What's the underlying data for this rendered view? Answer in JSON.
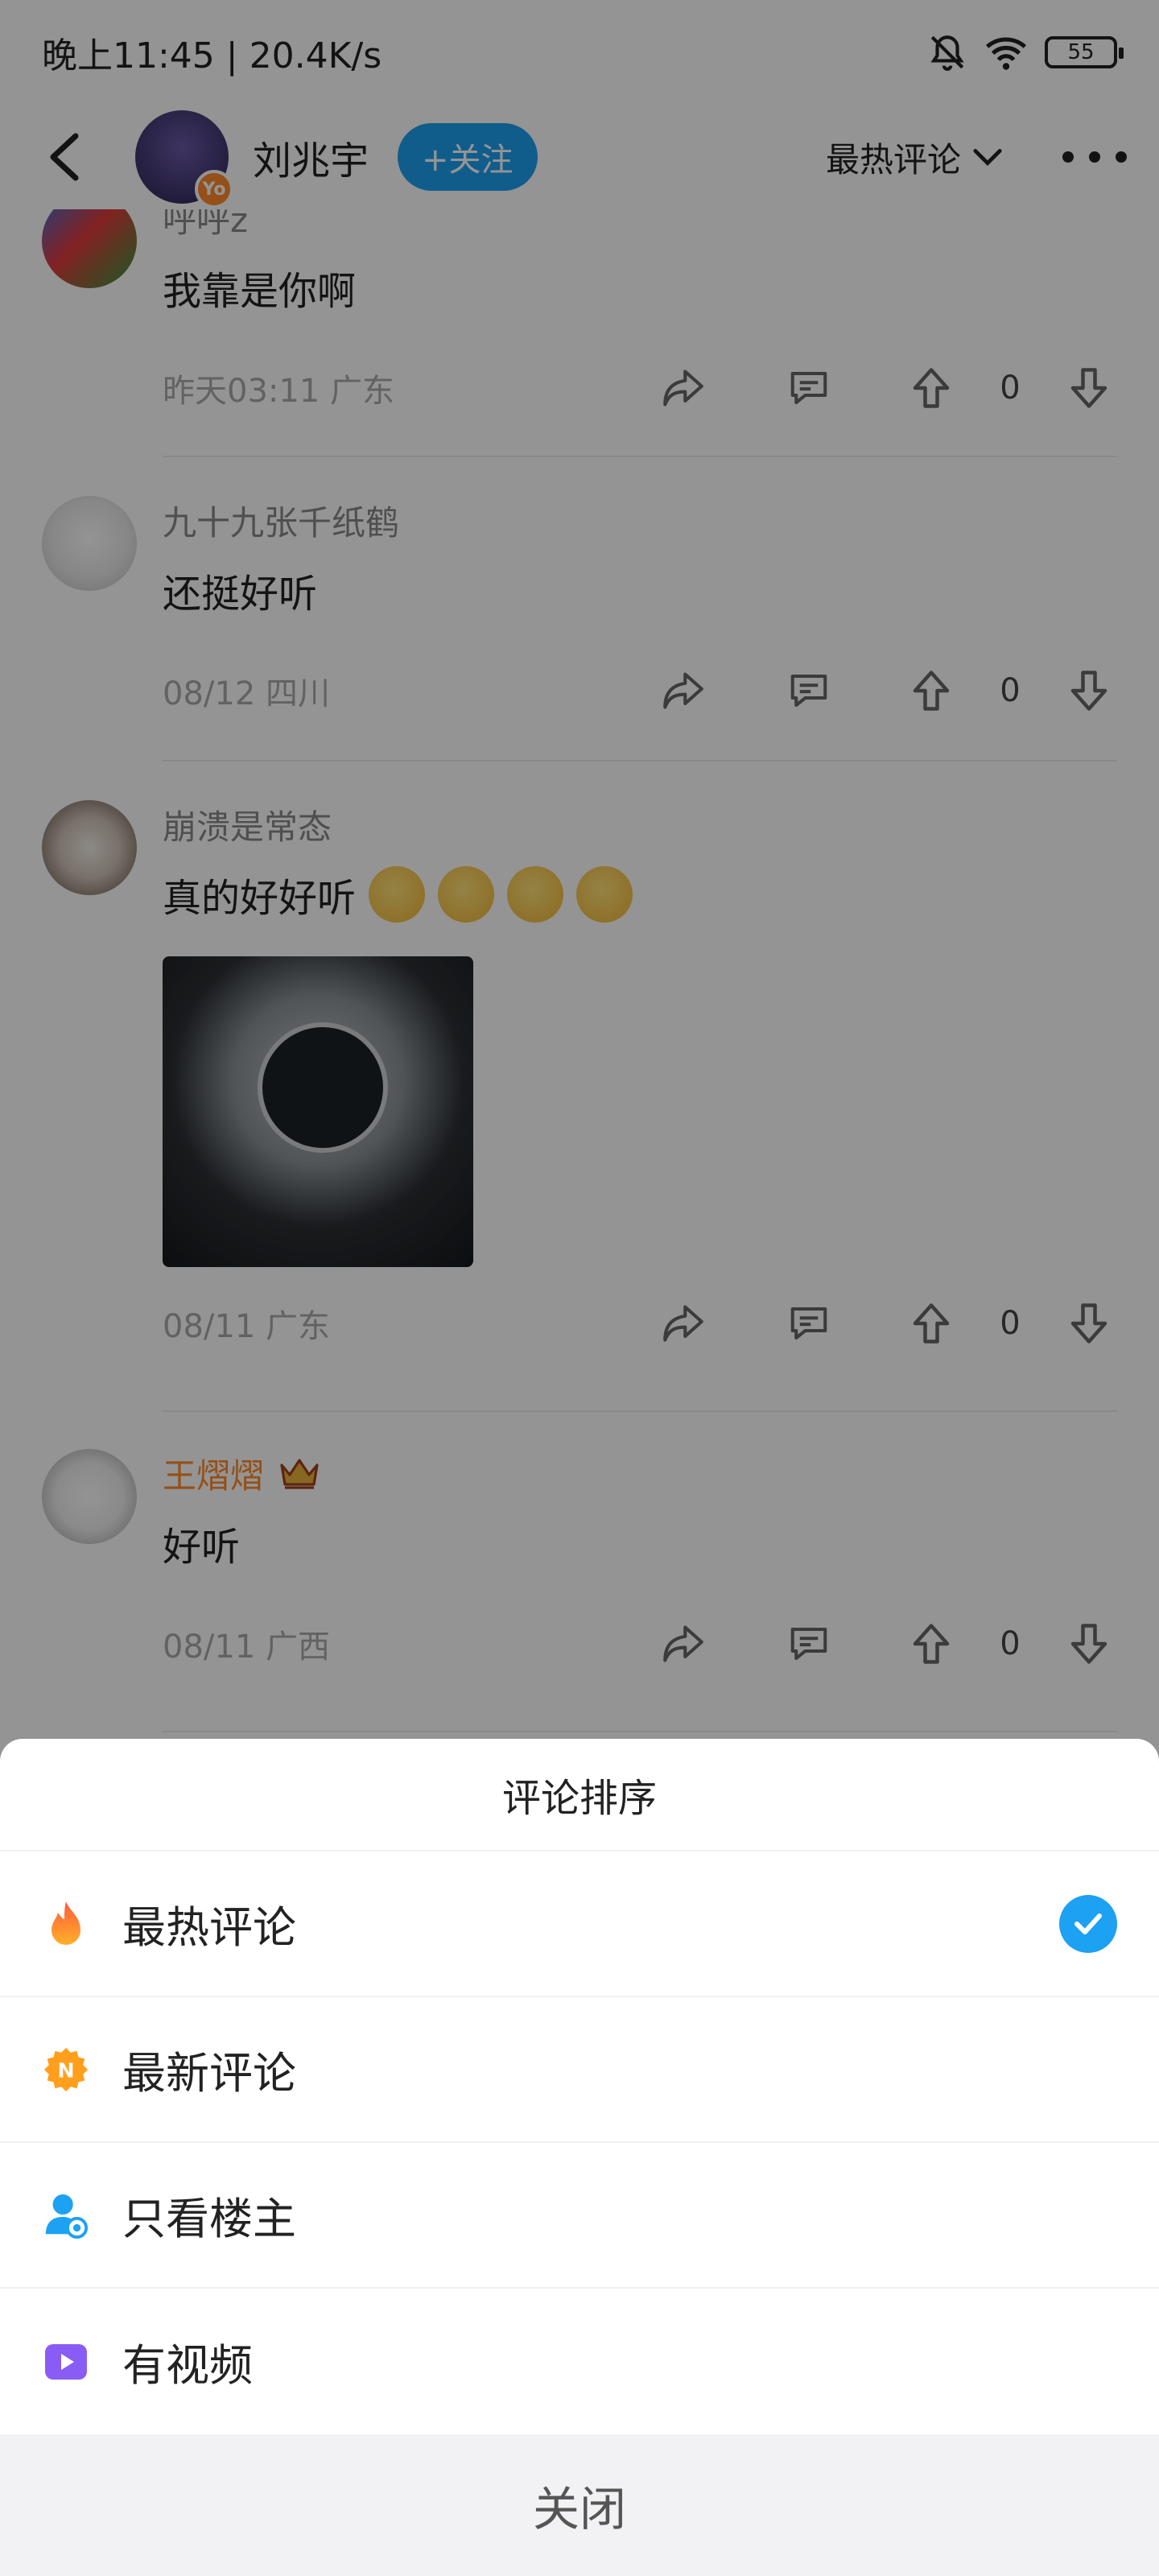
{
  "status_bar": {
    "time": "晚上11:45 | 20.4K/s",
    "battery": "55"
  },
  "header": {
    "user_name": "刘兆宇",
    "avatar_badge": "Yo",
    "follow_label": "+关注",
    "sort_label": "最热评论"
  },
  "comments": [
    {
      "user": "呼呼z",
      "text": "我靠是你啊",
      "meta": "昨天03:11 广东",
      "votes": "0"
    },
    {
      "user": "九十九张千纸鹤",
      "text": "还挺好听",
      "meta": "08/12 四川",
      "votes": "0"
    },
    {
      "user": "崩溃是常态",
      "text": "真的好好听",
      "meta": "08/11 广东",
      "votes": "0"
    },
    {
      "user": "王熠熠",
      "text": "好听",
      "meta": "08/11 广西",
      "votes": "0"
    }
  ],
  "sheet": {
    "title": "评论排序",
    "options": [
      {
        "label": "最热评论",
        "icon": "fire-icon",
        "selected": true
      },
      {
        "label": "最新评论",
        "icon": "new-badge-icon",
        "selected": false
      },
      {
        "label": "只看楼主",
        "icon": "author-icon",
        "selected": false
      },
      {
        "label": "有视频",
        "icon": "video-icon",
        "selected": false
      }
    ],
    "close_label": "关闭"
  },
  "colors": {
    "accent": "#1da1f2",
    "vip_name": "#ff8a2a",
    "overlay": "rgba(0,0,0,0.42)"
  }
}
